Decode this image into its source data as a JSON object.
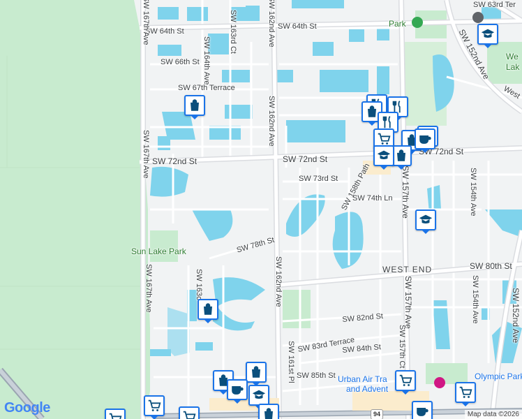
{
  "streets": {
    "sw_64th_st": "SW 64th St",
    "sw_63rd_ter": "SW 63rd Ter",
    "sw_163rd_ct": "SW 163rd Ct",
    "sw_164th_ave": "SW 164th Ave",
    "sw_66th_st": "SW 66th St",
    "sw_67th_terrace": "SW 67th Terrace",
    "sw_167th_ave_top": "SW 167th Ave",
    "sw_167th_ave_mid": "SW 167th Ave",
    "sw_167th_ave_bot": "SW 167th Ave",
    "sw_162nd_ave_top": "SW 162nd Ave",
    "sw_162nd_ave_bot": "SW 162nd Ave",
    "sw_72nd_st_left": "SW 72nd St",
    "sw_72nd_st_mid": "SW 72nd St",
    "sw_72nd_st_right": "SW 72nd St",
    "sw_73rd_st": "SW 73rd St",
    "sw_158th_path": "SW 158th Path",
    "sw_74th_ln": "SW 74th Ln",
    "sw_157th_ave": "SW 157th Ave",
    "sw_157th_ave_2": "SW 157th Ave",
    "sw_157th_ct": "SW 157th Ct",
    "sw_154th_ave": "SW 154th Ave",
    "sw_154th_ave_2": "SW 154th Ave",
    "sw_152nd_ave_top": "SW 152nd Ave",
    "sw_152nd_ave_bot": "SW 152nd Ave",
    "sw_78th_st": "SW 78th St",
    "west_end": "WEST END",
    "sw_80th_st": "SW 80th St",
    "sw_163c": "SW 163c",
    "sw_82nd_st": "SW 82nd St",
    "sw_83rd_terrace": "SW 83rd Terrace",
    "sw_84th_st": "SW 84th St",
    "sw_85th_st": "SW 85th St",
    "sw_161st_pl": "SW 161st Pl",
    "west_label": "West"
  },
  "places": {
    "sun_lake_park": "Sun Lake Park",
    "park_top": "Park",
    "urban_air_line1": "Urban Air Tra",
    "urban_air_line2": "and Advent",
    "olympic_park": "Olympic Park",
    "west_lake": "We",
    "west_lake2": "Lak"
  },
  "route_shield": "94",
  "branding": {
    "logo": "Google",
    "attribution": "Map data ©2026"
  },
  "icons": {
    "shopping": "shopping-bag-icon",
    "school": "school-icon",
    "cafe": "cafe-icon",
    "restaurant": "restaurant-icon",
    "grocery": "shopping-cart-icon",
    "park": "park-icon"
  },
  "colors": {
    "land": "#f1f3f4",
    "water": "#7fd3ec",
    "park": "#c8ebcf",
    "road": "#ffffff",
    "major_road": "#dadce0",
    "poi": "#0b4f7c"
  }
}
